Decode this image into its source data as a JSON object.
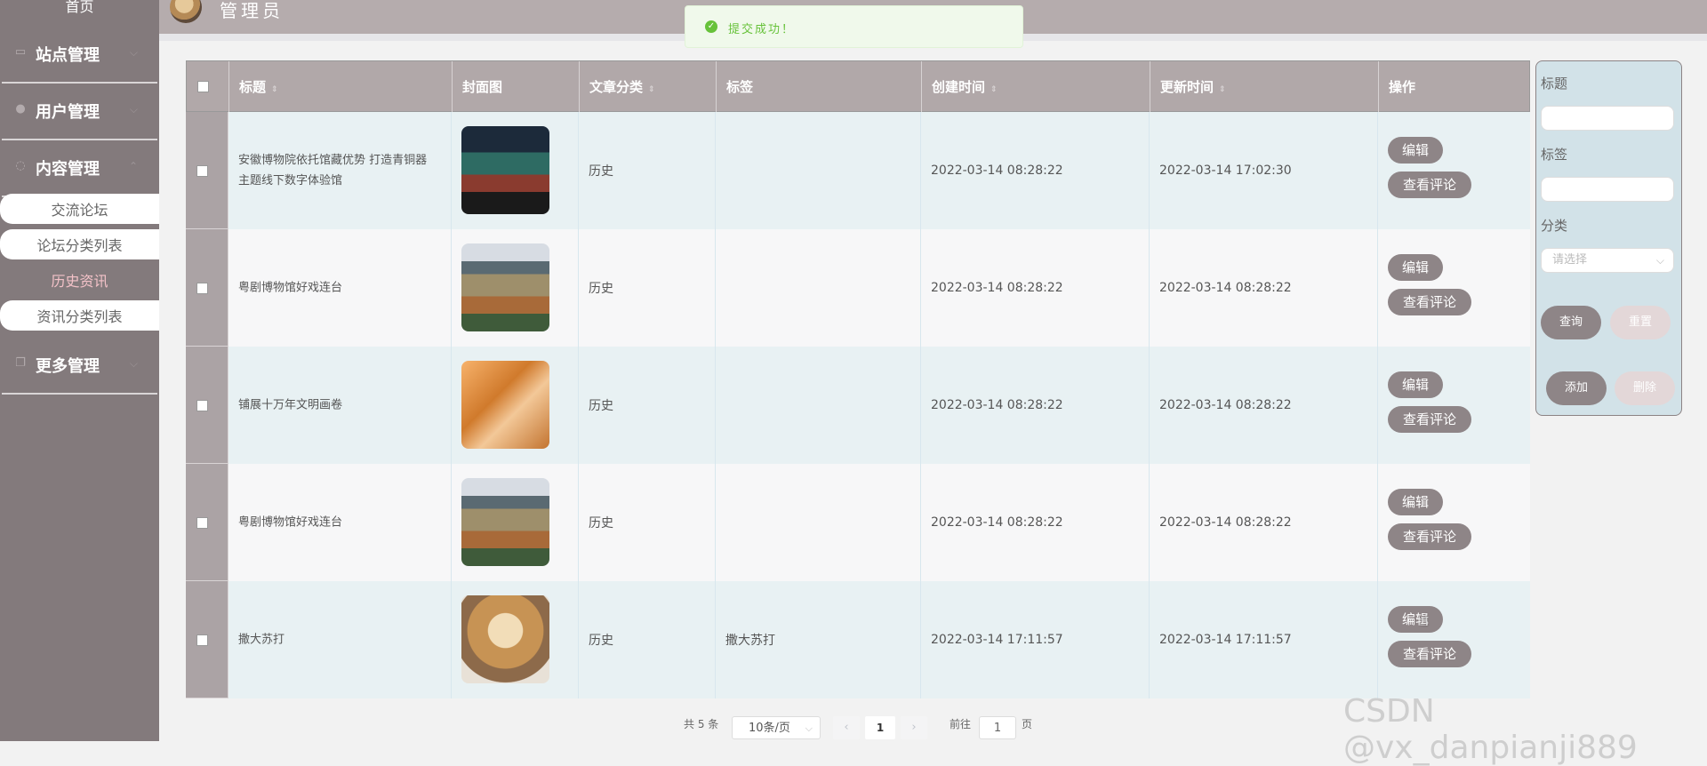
{
  "sidebar": {
    "home": "首页",
    "menus": [
      {
        "label": "站点管理",
        "icon": "monitor-icon"
      },
      {
        "label": "用户管理",
        "icon": "user-icon"
      },
      {
        "label": "内容管理",
        "icon": "chat-icon"
      },
      {
        "label": "更多管理",
        "icon": "copy-icon"
      }
    ],
    "submenu": [
      "交流论坛",
      "论坛分类列表",
      "历史资讯",
      "资讯分类列表"
    ],
    "active_submenu": "历史资讯"
  },
  "header": {
    "title": "管理员"
  },
  "toast": {
    "message": "提交成功！",
    "icon": "success-check-icon"
  },
  "table": {
    "columns": [
      "标题",
      "封面图",
      "文章分类",
      "标签",
      "创建时间",
      "更新时间",
      "操作"
    ],
    "rows": [
      {
        "title": "安徽博物院依托馆藏优势 打造青铜器主题线下数字体验馆",
        "category": "历史",
        "tag": "",
        "created": "2022-03-14 08:28:22",
        "updated": "2022-03-14 17:02:30"
      },
      {
        "title": "粤剧博物馆好戏连台",
        "category": "历史",
        "tag": "",
        "created": "2022-03-14 08:28:22",
        "updated": "2022-03-14 08:28:22"
      },
      {
        "title": "铺展十万年文明画卷",
        "category": "历史",
        "tag": "",
        "created": "2022-03-14 08:28:22",
        "updated": "2022-03-14 08:28:22"
      },
      {
        "title": "粤剧博物馆好戏连台",
        "category": "历史",
        "tag": "",
        "created": "2022-03-14 08:28:22",
        "updated": "2022-03-14 08:28:22"
      },
      {
        "title": "撒大苏打",
        "category": "历史",
        "tag": "撒大苏打",
        "created": "2022-03-14 17:11:57",
        "updated": "2022-03-14 17:11:57"
      }
    ],
    "actions": {
      "edit": "编辑",
      "comments": "查看评论"
    }
  },
  "search": {
    "title_label": "标题",
    "tag_label": "标签",
    "category_label": "分类",
    "category_placeholder": "请选择",
    "query": "查询",
    "reset": "重置",
    "add": "添加",
    "delete": "删除"
  },
  "pagination": {
    "total": "共 5 条",
    "page_size": "10条/页",
    "current_page": "1",
    "goto_label": "前往",
    "goto_value": "1",
    "page_suffix": "页"
  },
  "watermark": "CSDN @vx_danpianji889"
}
